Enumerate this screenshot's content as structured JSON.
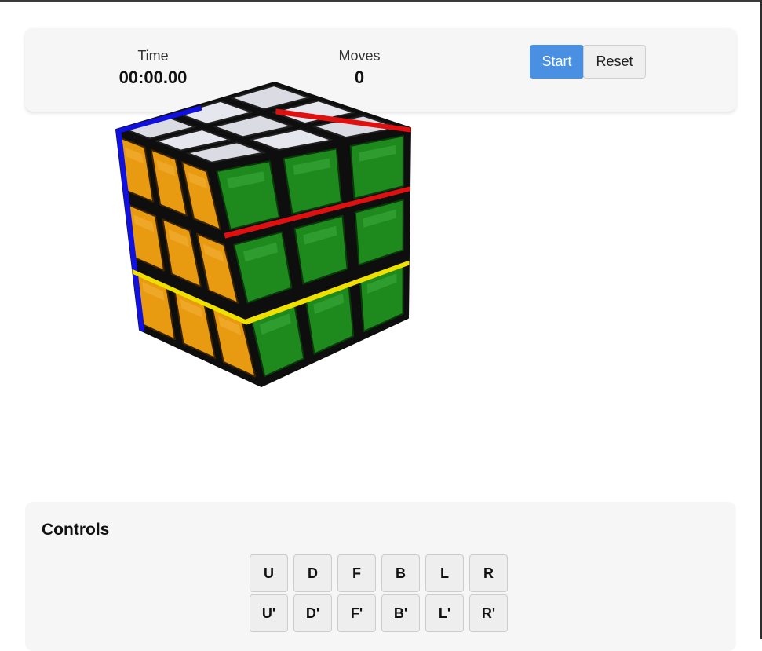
{
  "stats": {
    "time_label": "Time",
    "time_value": "00:00.00",
    "moves_label": "Moves",
    "moves_value": "0"
  },
  "buttons": {
    "start": "Start",
    "reset": "Reset"
  },
  "colors": {
    "accent": "#4a90e2",
    "cube_front": "#e89a10",
    "cube_right": "#1e8a1e",
    "cube_top": "#f2f2f2",
    "edge_blue": "#1010e0",
    "edge_red": "#e01010",
    "edge_yellow": "#f0e000"
  },
  "controls": {
    "title": "Controls",
    "rows": [
      [
        "U",
        "D",
        "F",
        "B",
        "L",
        "R"
      ],
      [
        "U'",
        "D'",
        "F'",
        "B'",
        "L'",
        "R'"
      ]
    ]
  }
}
